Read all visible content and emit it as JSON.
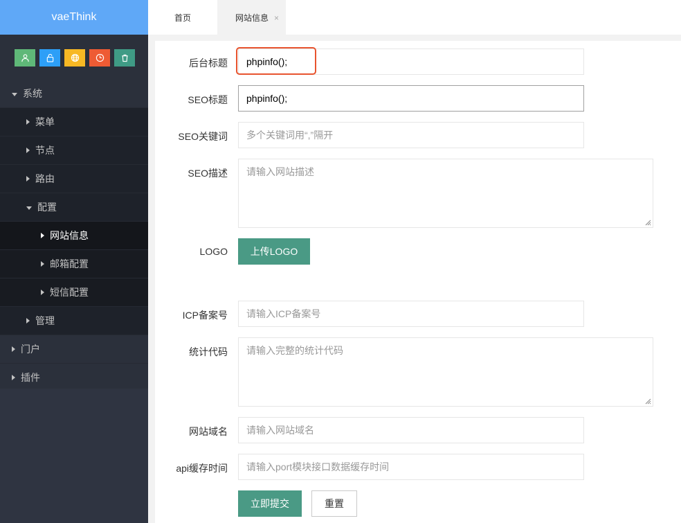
{
  "app": {
    "logo_text": "vaeThink"
  },
  "quick_icons": [
    {
      "icon": "user-icon",
      "color": "#5fb878"
    },
    {
      "icon": "lock-icon",
      "color": "#2d9ff7"
    },
    {
      "icon": "globe-icon",
      "color": "#f7b824"
    },
    {
      "icon": "clock-icon",
      "color": "#ee5b34"
    },
    {
      "icon": "trash-icon",
      "color": "#3f9b85"
    }
  ],
  "sidebar": {
    "system": "系统",
    "menu": "菜单",
    "node": "节点",
    "route": "路由",
    "config": "配置",
    "site_info": "网站信息",
    "mail_config": "邮箱配置",
    "sms_config": "短信配置",
    "manage": "管理",
    "portal": "门户",
    "plugins": "插件"
  },
  "tabs": {
    "home": "首页",
    "site_info": "网站信息",
    "close": "×"
  },
  "form": {
    "backend_title_label": "后台标题",
    "backend_title_value": "phpinfo();",
    "seo_title_label": "SEO标题",
    "seo_title_value": "phpinfo();",
    "seo_keywords_label": "SEO关键词",
    "seo_keywords_placeholder": "多个关键词用“,”隔开",
    "seo_desc_label": "SEO描述",
    "seo_desc_placeholder": "请输入网站描述",
    "logo_label": "LOGO",
    "upload_logo": "上传LOGO",
    "icp_label": "ICP备案号",
    "icp_placeholder": "请输入ICP备案号",
    "stats_label": "统计代码",
    "stats_placeholder": "请输入完整的统计代码",
    "domain_label": "网站域名",
    "domain_placeholder": "请输入网站域名",
    "api_cache_label": "api缓存时间",
    "api_cache_placeholder": "请输入port模块接口数据缓存时间",
    "submit": "立即提交",
    "reset": "重置"
  },
  "colors": {
    "logo_bg": "#5fa8f7",
    "sidebar_bg": "#2b303b",
    "primary_button": "#4a9a85",
    "highlight": "#e8542e"
  }
}
